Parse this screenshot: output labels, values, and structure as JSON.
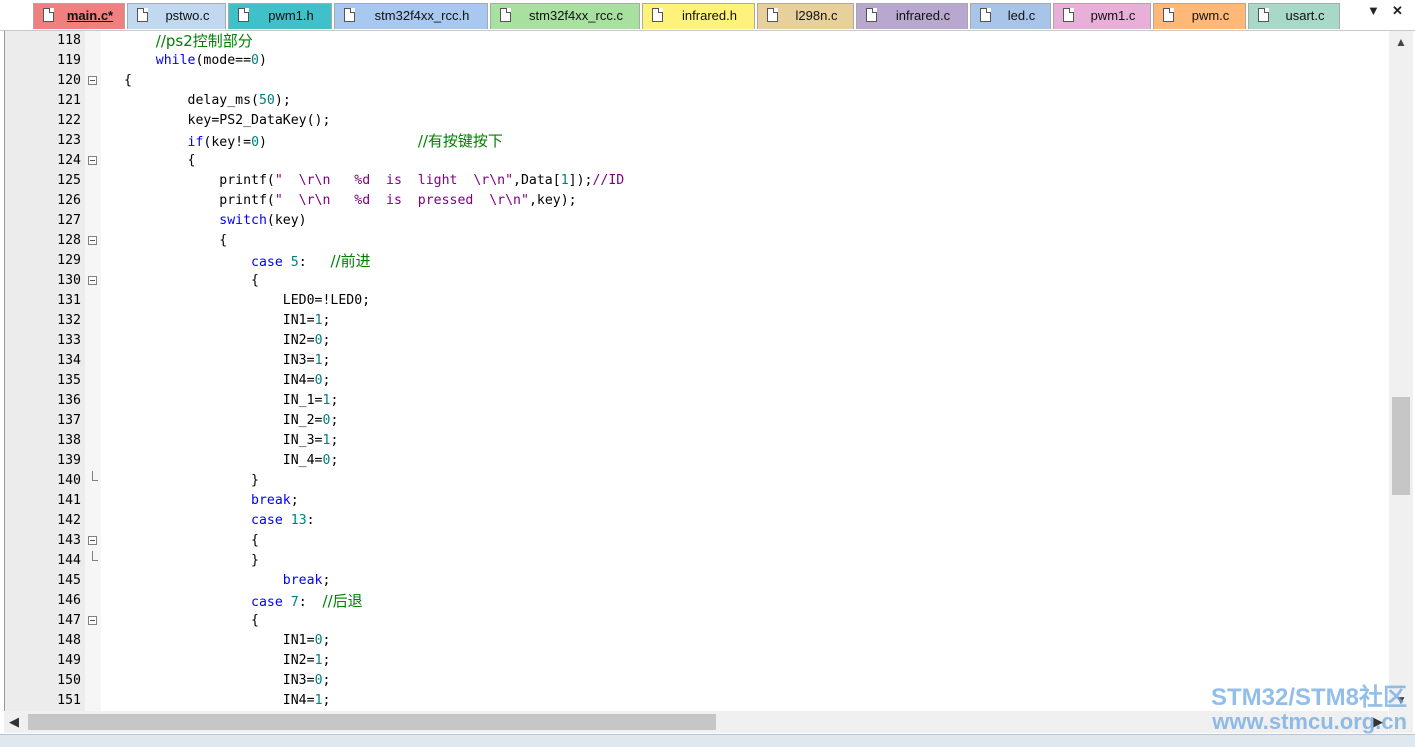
{
  "tabs": [
    {
      "label": "main.c*",
      "color": "#f08080",
      "active": true
    },
    {
      "label": "pstwo.c",
      "color": "#c0d8f0",
      "active": false
    },
    {
      "label": "pwm1.h",
      "color": "#40c0c8",
      "active": false
    },
    {
      "label": "stm32f4xx_rcc.h",
      "color": "#a8c8f0",
      "active": false
    },
    {
      "label": "stm32f4xx_rcc.c",
      "color": "#a8e0a0",
      "active": false
    },
    {
      "label": "infrared.h",
      "color": "#fff27a",
      "active": false
    },
    {
      "label": "l298n.c",
      "color": "#e8d09c",
      "active": false
    },
    {
      "label": "infrared.c",
      "color": "#b8a8d0",
      "active": false
    },
    {
      "label": "led.c",
      "color": "#a8c4e8",
      "active": false
    },
    {
      "label": "pwm1.c",
      "color": "#e8b0d8",
      "active": false
    },
    {
      "label": "pwm.c",
      "color": "#ffb878",
      "active": false
    },
    {
      "label": "usart.c",
      "color": "#a8d8c8",
      "active": false
    }
  ],
  "tab_controls": {
    "dropdown": "▼",
    "close": "✕"
  },
  "scrollbar": {
    "up": "▲",
    "down": "▼",
    "left": "◀",
    "right": "▶"
  },
  "lines": [
    {
      "n": "118",
      "fold": "",
      "tokens": [
        [
          "    ",
          "def"
        ],
        [
          "//ps2控制部分",
          "cmt"
        ]
      ]
    },
    {
      "n": "119",
      "fold": "",
      "tokens": [
        [
          "    ",
          "def"
        ],
        [
          "while",
          "kw"
        ],
        [
          "(mode==",
          "def"
        ],
        [
          "0",
          "num"
        ],
        [
          ")",
          "def"
        ]
      ]
    },
    {
      "n": "120",
      "fold": "box",
      "tokens": [
        [
          "{",
          "def"
        ]
      ]
    },
    {
      "n": "121",
      "fold": "",
      "tokens": [
        [
          "        delay_ms(",
          "def"
        ],
        [
          "50",
          "num"
        ],
        [
          ");",
          "def"
        ]
      ]
    },
    {
      "n": "122",
      "fold": "",
      "tokens": [
        [
          "        key=PS2_DataKey();",
          "def"
        ]
      ]
    },
    {
      "n": "123",
      "fold": "",
      "tokens": [
        [
          "        ",
          "def"
        ],
        [
          "if",
          "kw"
        ],
        [
          "(key!=",
          "def"
        ],
        [
          "0",
          "num"
        ],
        [
          ")                   ",
          "def"
        ],
        [
          "//有按键按下",
          "cmt"
        ]
      ]
    },
    {
      "n": "124",
      "fold": "box",
      "tokens": [
        [
          "        {",
          "def"
        ]
      ]
    },
    {
      "n": "125",
      "fold": "",
      "tokens": [
        [
          "            printf(",
          "def"
        ],
        [
          "\"  \\r\\n   %d  is  light  \\r\\n\"",
          "str"
        ],
        [
          ",Data[",
          "def"
        ],
        [
          "1",
          "num"
        ],
        [
          "]);",
          "def"
        ],
        [
          "//ID",
          "str"
        ]
      ]
    },
    {
      "n": "126",
      "fold": "",
      "tokens": [
        [
          "            printf(",
          "def"
        ],
        [
          "\"  \\r\\n   %d  is  pressed  \\r\\n\"",
          "str"
        ],
        [
          ",key);",
          "def"
        ]
      ]
    },
    {
      "n": "127",
      "fold": "",
      "tokens": [
        [
          "            ",
          "def"
        ],
        [
          "switch",
          "kw"
        ],
        [
          "(key)",
          "def"
        ]
      ]
    },
    {
      "n": "128",
      "fold": "box",
      "tokens": [
        [
          "            {",
          "def"
        ]
      ]
    },
    {
      "n": "129",
      "fold": "",
      "tokens": [
        [
          "                ",
          "def"
        ],
        [
          "case",
          "kw"
        ],
        [
          " ",
          "def"
        ],
        [
          "5",
          "num"
        ],
        [
          ":   ",
          "def"
        ],
        [
          "//前进",
          "cmt"
        ]
      ]
    },
    {
      "n": "130",
      "fold": "box",
      "tokens": [
        [
          "                {",
          "def"
        ]
      ]
    },
    {
      "n": "131",
      "fold": "",
      "tokens": [
        [
          "                    LED0=!LED0;",
          "def"
        ]
      ]
    },
    {
      "n": "132",
      "fold": "",
      "tokens": [
        [
          "                    IN1=",
          "def"
        ],
        [
          "1",
          "num"
        ],
        [
          ";",
          "def"
        ]
      ]
    },
    {
      "n": "133",
      "fold": "",
      "tokens": [
        [
          "                    IN2=",
          "def"
        ],
        [
          "0",
          "num"
        ],
        [
          ";",
          "def"
        ]
      ]
    },
    {
      "n": "134",
      "fold": "",
      "tokens": [
        [
          "                    IN3=",
          "def"
        ],
        [
          "1",
          "num"
        ],
        [
          ";",
          "def"
        ]
      ]
    },
    {
      "n": "135",
      "fold": "",
      "tokens": [
        [
          "                    IN4=",
          "def"
        ],
        [
          "0",
          "num"
        ],
        [
          ";",
          "def"
        ]
      ]
    },
    {
      "n": "136",
      "fold": "",
      "tokens": [
        [
          "                    IN_1=",
          "def"
        ],
        [
          "1",
          "num"
        ],
        [
          ";",
          "def"
        ]
      ]
    },
    {
      "n": "137",
      "fold": "",
      "tokens": [
        [
          "                    IN_2=",
          "def"
        ],
        [
          "0",
          "num"
        ],
        [
          ";",
          "def"
        ]
      ]
    },
    {
      "n": "138",
      "fold": "",
      "tokens": [
        [
          "                    IN_3=",
          "def"
        ],
        [
          "1",
          "num"
        ],
        [
          ";",
          "def"
        ]
      ]
    },
    {
      "n": "139",
      "fold": "",
      "tokens": [
        [
          "                    IN_4=",
          "def"
        ],
        [
          "0",
          "num"
        ],
        [
          ";",
          "def"
        ]
      ]
    },
    {
      "n": "140",
      "fold": "end",
      "tokens": [
        [
          "                }",
          "def"
        ]
      ]
    },
    {
      "n": "141",
      "fold": "",
      "tokens": [
        [
          "                ",
          "def"
        ],
        [
          "break",
          "kw"
        ],
        [
          ";",
          "def"
        ]
      ]
    },
    {
      "n": "142",
      "fold": "",
      "tokens": [
        [
          "                ",
          "def"
        ],
        [
          "case",
          "kw"
        ],
        [
          " ",
          "def"
        ],
        [
          "13",
          "num"
        ],
        [
          ":",
          "def"
        ]
      ]
    },
    {
      "n": "143",
      "fold": "box",
      "tokens": [
        [
          "                {",
          "def"
        ]
      ]
    },
    {
      "n": "144",
      "fold": "end",
      "tokens": [
        [
          "                }",
          "def"
        ]
      ]
    },
    {
      "n": "145",
      "fold": "",
      "tokens": [
        [
          "                    ",
          "def"
        ],
        [
          "break",
          "kw"
        ],
        [
          ";",
          "def"
        ]
      ]
    },
    {
      "n": "146",
      "fold": "",
      "tokens": [
        [
          "                ",
          "def"
        ],
        [
          "case",
          "kw"
        ],
        [
          " ",
          "def"
        ],
        [
          "7",
          "num"
        ],
        [
          ":  ",
          "def"
        ],
        [
          "//后退",
          "cmt"
        ]
      ]
    },
    {
      "n": "147",
      "fold": "box",
      "tokens": [
        [
          "                {",
          "def"
        ]
      ]
    },
    {
      "n": "148",
      "fold": "",
      "tokens": [
        [
          "                    IN1=",
          "def"
        ],
        [
          "0",
          "num"
        ],
        [
          ";",
          "def"
        ]
      ]
    },
    {
      "n": "149",
      "fold": "",
      "tokens": [
        [
          "                    IN2=",
          "def"
        ],
        [
          "1",
          "num"
        ],
        [
          ";",
          "def"
        ]
      ]
    },
    {
      "n": "150",
      "fold": "",
      "tokens": [
        [
          "                    IN3=",
          "def"
        ],
        [
          "0",
          "num"
        ],
        [
          ";",
          "def"
        ]
      ]
    },
    {
      "n": "151",
      "fold": "",
      "tokens": [
        [
          "                    IN4=",
          "def"
        ],
        [
          "1",
          "num"
        ],
        [
          ";",
          "def"
        ]
      ]
    }
  ],
  "watermark": {
    "line1": "STM32/STM8社区",
    "line2": "www.stmcu.org.cn"
  }
}
